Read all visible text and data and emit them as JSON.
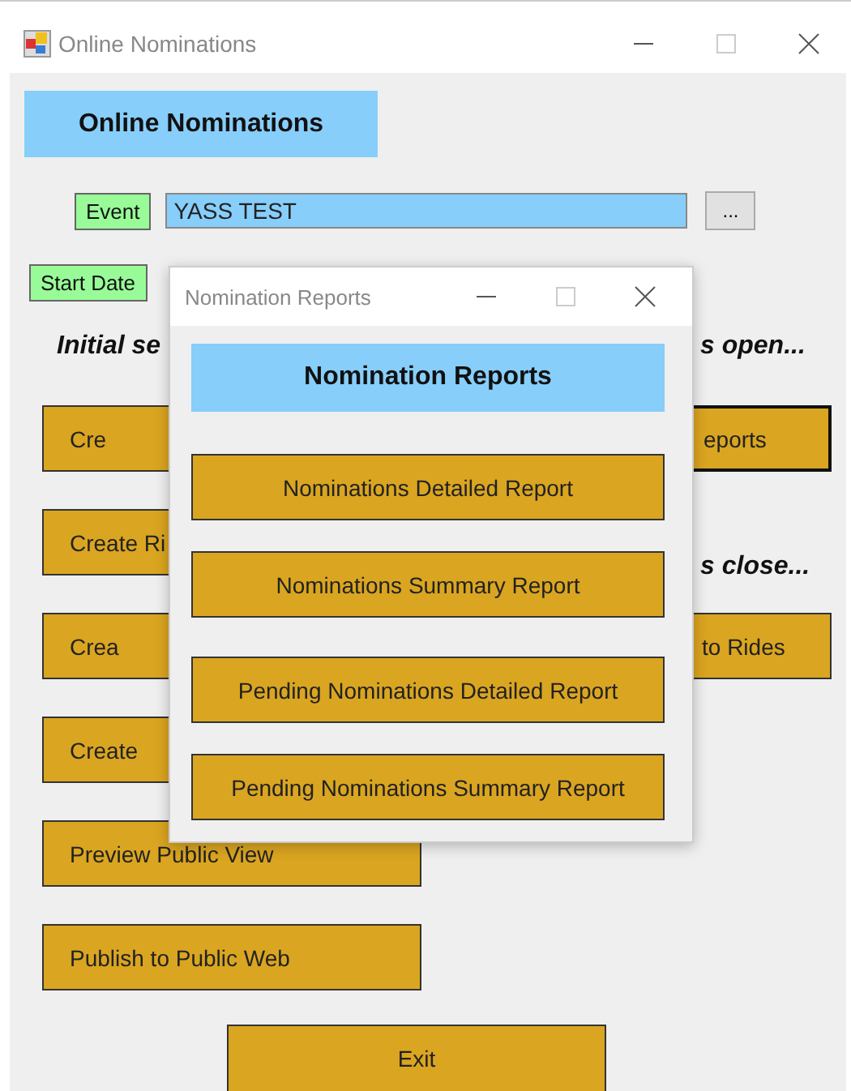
{
  "main_window": {
    "title": "Online Nominations",
    "heading": "Online Nominations",
    "event": {
      "label": "Event",
      "value": "YASS TEST",
      "browse_button": "..."
    },
    "start_date": {
      "label": "Start Date"
    },
    "section_open_left": "Initial se",
    "section_open_right": "s open...",
    "section_close_right": "s close...",
    "buttons_left": [
      "Cre",
      "Create Ri",
      "Crea",
      "Create",
      "Preview Public View",
      "Publish to Public Web"
    ],
    "buttons_right": [
      {
        "label": "eports",
        "focused": true
      },
      {
        "label": "to Rides",
        "focused": false
      }
    ],
    "exit_button": "Exit"
  },
  "dialog": {
    "title": "Nomination Reports",
    "heading": "Nomination Reports",
    "buttons": [
      "Nominations Detailed Report",
      "Nominations Summary Report",
      "Pending Nominations Detailed Report",
      "Pending Nominations Summary Report"
    ]
  }
}
